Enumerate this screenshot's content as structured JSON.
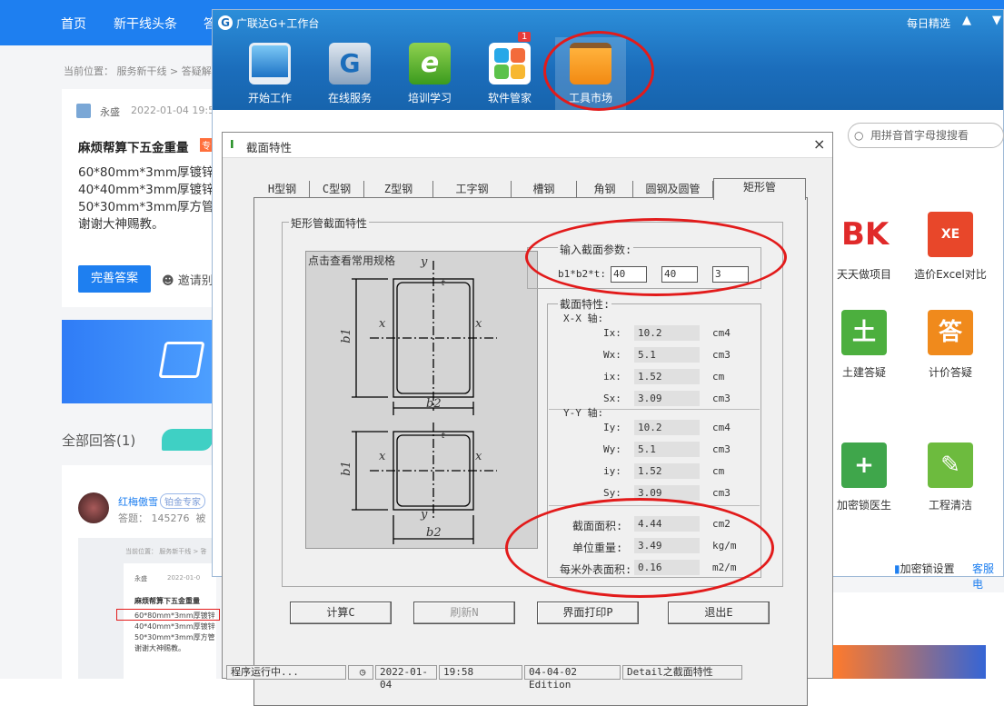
{
  "web": {
    "nav": [
      "首页",
      "新干线头条",
      "答"
    ],
    "breadcrumb": "当前位置： 服务新干线 > 答疑解",
    "asker": "永盛",
    "ask_date": "2022-01-04 19:5",
    "question_title": "麻烦帮算下五金重量",
    "question_tag": "专",
    "question_lines": [
      "60*80mm*3mm厚镀锌",
      "40*40mm*3mm厚镀锌",
      "50*30mm*3mm厚方管",
      "谢谢大神赐教。"
    ],
    "improve_answer": "完善答案",
    "invite": "邀请别",
    "all_answers": "全部回答(1)",
    "answerer": "红梅傲雪",
    "answerer_badge": "铂金专家",
    "answer_meta": "答题： 145276  被",
    "thumb_breadcrumb": "当前位置： 服务新干线 > 答",
    "thumb_asker": "永盛",
    "thumb_date": "2022-01-0",
    "thumb_title": "麻烦帮算下五金重量",
    "thumb_lines": [
      "60*80mm*3mm厚镀锌",
      "40*40mm*3mm厚镀锌",
      "50*30mm*3mm厚方管",
      "谢谢大神赐教。"
    ]
  },
  "workstation": {
    "title": "广联达G+工作台",
    "daily": "每日精选",
    "tools": [
      "开始工作",
      "在线服务",
      "培训学习",
      "软件管家",
      "工具市场"
    ],
    "badge": "1",
    "search_placeholder": "用拼音首字母搜搜看",
    "apps": [
      "天天做项目",
      "造价Excel对比",
      "土建答疑",
      "计价答疑",
      "加密锁医生",
      "工程清洁"
    ],
    "lock_settings": "加密锁设置",
    "service": "客服电"
  },
  "dialog": {
    "title": "截面特性",
    "close": "×",
    "tabs": [
      "H型钢",
      "C型钢",
      "Z型钢",
      "工字钢",
      "槽钢",
      "角钢",
      "圆钢及圆管",
      "矩形管"
    ],
    "group_title": "矩形管截面特性",
    "spec_label": "点击查看常用规格",
    "input_group": "输入截面参数:",
    "input_label": "b1*b2*t:",
    "inputs": [
      "40",
      "40",
      "3"
    ],
    "props_group": "截面特性:",
    "xx_axis": "X-X 轴:",
    "yy_axis": "Y-Y 轴:",
    "xx": [
      {
        "name": "Ix:",
        "value": "10.2",
        "unit": "cm4"
      },
      {
        "name": "Wx:",
        "value": "5.1",
        "unit": "cm3"
      },
      {
        "name": "ix:",
        "value": "1.52",
        "unit": "cm"
      },
      {
        "name": "Sx:",
        "value": "3.09",
        "unit": "cm3"
      }
    ],
    "yy": [
      {
        "name": "Iy:",
        "value": "10.2",
        "unit": "cm4"
      },
      {
        "name": "Wy:",
        "value": "5.1",
        "unit": "cm3"
      },
      {
        "name": "iy:",
        "value": "1.52",
        "unit": "cm"
      },
      {
        "name": "Sy:",
        "value": "3.09",
        "unit": "cm3"
      }
    ],
    "summary": [
      {
        "name": "截面面积:",
        "value": "4.44",
        "unit": "cm2"
      },
      {
        "name": "单位重量:",
        "value": "3.49",
        "unit": "kg/m"
      },
      {
        "name": "每米外表面积:",
        "value": "0.16",
        "unit": "m2/m"
      }
    ],
    "buttons": [
      "计算C",
      "刷新N",
      "界面打印P",
      "退出E"
    ],
    "status": [
      "程序运行中...",
      "2022-01-04",
      "19:58",
      "04-04-02 Edition",
      "Detail之截面特性"
    ],
    "diagram": {
      "y": "y",
      "x": "x",
      "b1": "b1",
      "b2": "b2",
      "t": "t"
    }
  }
}
